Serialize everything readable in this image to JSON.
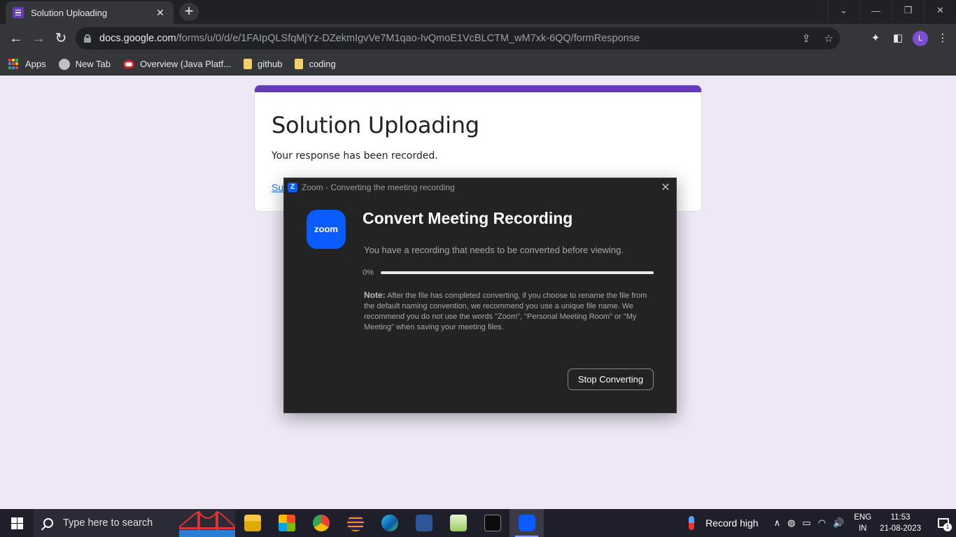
{
  "browser": {
    "tab_title": "Solution Uploading",
    "url_host": "docs.google.com",
    "url_path": "/forms/u/0/d/e/1FAIpQLSfqMjYz-DZekmIgvVe7M1qao-IvQmoE1VcBLCTM_wM7xk-6QQ/formResponse",
    "avatar_initial": "L",
    "bookmarks": [
      "Apps",
      "New Tab",
      "Overview (Java Platf...",
      "github",
      "coding"
    ]
  },
  "form": {
    "title": "Solution Uploading",
    "message": "Your response has been recorded.",
    "link_partial": "Su",
    "accent_color": "#673ab7"
  },
  "zoom_dialog": {
    "window_title": "Zoom - Converting the meeting recording",
    "logo_text": "zoom",
    "heading": "Convert Meeting Recording",
    "subtitle": "You have a recording that needs to be converted before viewing.",
    "progress_label": "0%",
    "progress_value": 0,
    "note_label": "Note:",
    "note_text": "After the file has completed converting, if you choose to rename the file from the default naming convention, we recommend you use a unique file name. We recommend you do not use the words \"Zoom\", \"Personal Meeting Room\" or \"My Meeting\" when saving your meeting files.",
    "stop_button": "Stop Converting",
    "accent_color": "#0b5cff"
  },
  "taskbar": {
    "search_placeholder": "Type here to search",
    "weather_text": "Record high",
    "lang_line1": "ENG",
    "lang_line2": "IN",
    "time": "11:53",
    "date": "21-08-2023",
    "notification_count": "1"
  }
}
